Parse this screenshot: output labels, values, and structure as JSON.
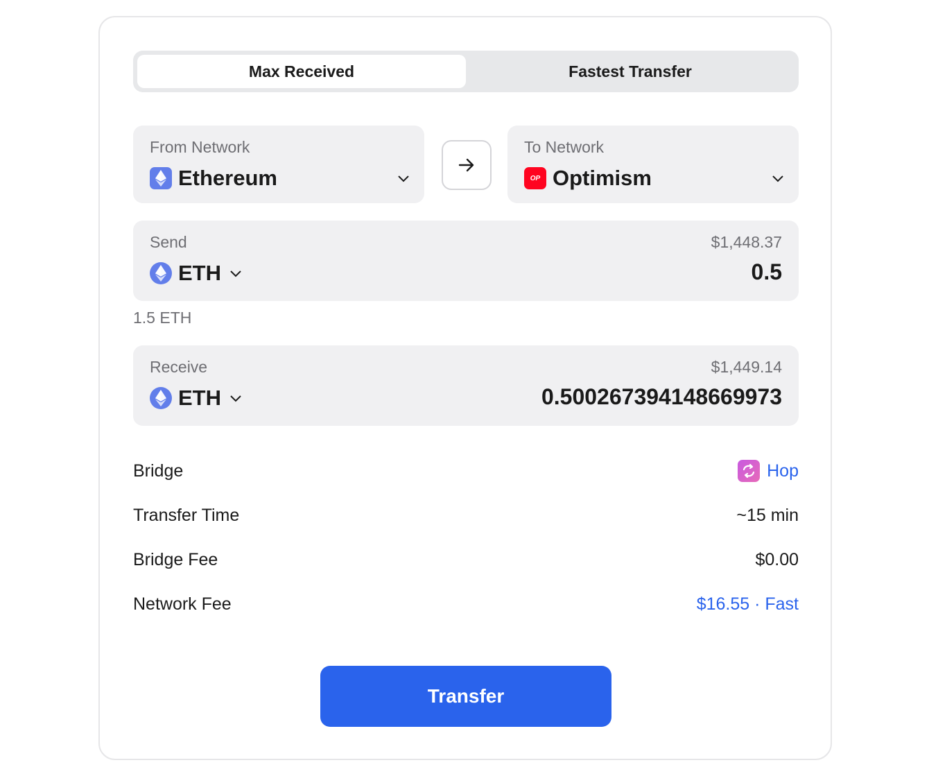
{
  "tabs": [
    {
      "label": "Max Received",
      "active": true
    },
    {
      "label": "Fastest Transfer",
      "active": false
    }
  ],
  "from_network": {
    "label": "From Network",
    "value": "Ethereum",
    "icon": "ethereum-icon"
  },
  "swap_button": {
    "icon": "arrow-right-icon"
  },
  "to_network": {
    "label": "To Network",
    "value": "Optimism",
    "icon": "optimism-icon",
    "icon_text": "OP"
  },
  "send": {
    "label": "Send",
    "usd_value": "$1,448.37",
    "token": "ETH",
    "amount": "0.5"
  },
  "balance": "1.5 ETH",
  "receive": {
    "label": "Receive",
    "usd_value": "$1,449.14",
    "token": "ETH",
    "amount": "0.500267394148669973"
  },
  "details": [
    {
      "label": "Bridge",
      "value": "Hop",
      "icon": "hop-icon",
      "link": true
    },
    {
      "label": "Transfer Time",
      "value": "~15 min",
      "link": false
    },
    {
      "label": "Bridge Fee",
      "value": "$0.00",
      "link": false
    },
    {
      "label": "Network Fee",
      "value": "$16.55 · Fast",
      "link": true
    }
  ],
  "transfer_button": "Transfer",
  "colors": {
    "accent": "#2a63ec",
    "ethereum": "#627eea",
    "optimism": "#ff0420",
    "panel_bg": "#f0f0f2",
    "muted_text": "#6e6e73"
  }
}
